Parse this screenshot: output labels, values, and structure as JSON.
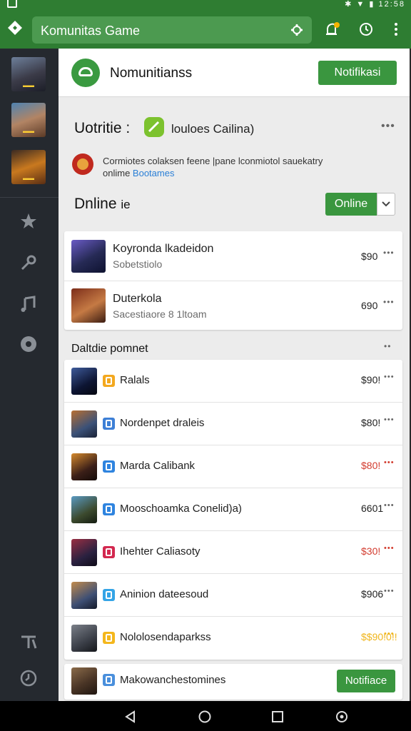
{
  "status_bar": {
    "time": "12:58"
  },
  "appbar": {
    "search_text": "Komunitas Game"
  },
  "header": {
    "title": "Nomunitianss",
    "button": "Notifikasi"
  },
  "featured": {
    "title": "Uotritie :",
    "tag_text": "louloes Cailina)",
    "notice_line1": "Cormiotes colaksen feene |pane lconmiotol sauekatry",
    "notice_line2_prefix": "onlime",
    "notice_link": "Bootames"
  },
  "online": {
    "title": "Dnline",
    "title_suffix": "ie",
    "filter": "Online",
    "items": [
      {
        "name": "Koyronda lkadeidon",
        "sub": "Sobetstiolo",
        "value": "$90"
      },
      {
        "name": "Duterkola",
        "sub": "Sacestiaore 8 1ltoam",
        "value": "690"
      }
    ]
  },
  "daftar": {
    "title": "Daltdie pomnet",
    "items": [
      {
        "name": "Ralals",
        "value": "$90!",
        "value_color": "#222222",
        "badge_color": "#f3a81f"
      },
      {
        "name": "Nordenpet draleis",
        "value": "$80!",
        "value_color": "#222222",
        "badge_color": "#3d7fd6"
      },
      {
        "name": "Marda Calibank",
        "value": "$80!",
        "value_color": "#d23b2e",
        "badge_color": "#2f84df"
      },
      {
        "name": "Mooschoamka Conelid)a)",
        "value": "6601",
        "value_color": "#222222",
        "badge_color": "#2f84df"
      },
      {
        "name": "Ihehter Caliasoty",
        "value": "$30!",
        "value_color": "#d23b2e",
        "badge_color": "#d3284f"
      },
      {
        "name": "Aninion dateesoud",
        "value": "$906",
        "value_color": "#222222",
        "badge_color": "#34a4e6"
      },
      {
        "name": "Nololosendaparkss",
        "value": "$$90!0!!",
        "value_color": "#f0b51c",
        "badge_color": "#f4b71c"
      }
    ]
  },
  "footer_item": {
    "name": "Makowanchestomines",
    "button": "Notifiace",
    "badge_color": "#4a8fdc"
  }
}
